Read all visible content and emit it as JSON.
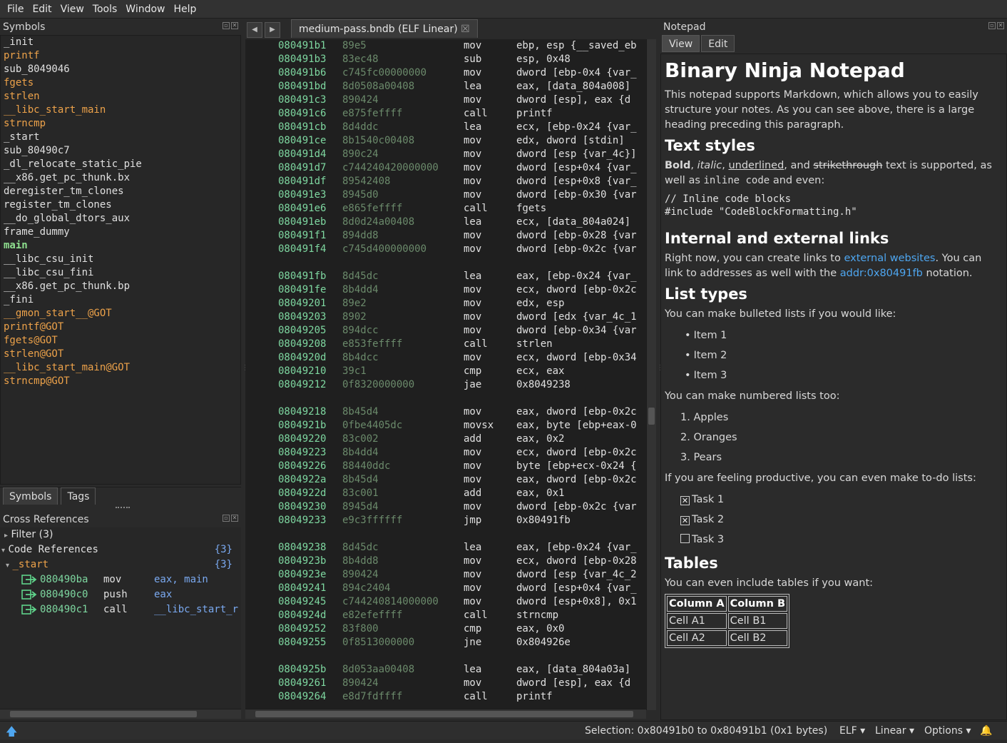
{
  "menu": [
    "File",
    "Edit",
    "View",
    "Tools",
    "Window",
    "Help"
  ],
  "symbols_pane": {
    "title": "Symbols",
    "items": [
      {
        "name": "_init",
        "color": "white"
      },
      {
        "name": "printf",
        "color": "orange"
      },
      {
        "name": "sub_8049046",
        "color": "white"
      },
      {
        "name": "fgets",
        "color": "orange"
      },
      {
        "name": "strlen",
        "color": "orange"
      },
      {
        "name": "__libc_start_main",
        "color": "orange"
      },
      {
        "name": "strncmp",
        "color": "orange"
      },
      {
        "name": "_start",
        "color": "white"
      },
      {
        "name": "sub_80490c7",
        "color": "white"
      },
      {
        "name": "_dl_relocate_static_pie",
        "color": "white"
      },
      {
        "name": "__x86.get_pc_thunk.bx",
        "color": "white"
      },
      {
        "name": "deregister_tm_clones",
        "color": "white"
      },
      {
        "name": "register_tm_clones",
        "color": "white"
      },
      {
        "name": "__do_global_dtors_aux",
        "color": "white"
      },
      {
        "name": "frame_dummy",
        "color": "white"
      },
      {
        "name": "main",
        "color": "green"
      },
      {
        "name": "__libc_csu_init",
        "color": "white"
      },
      {
        "name": "__libc_csu_fini",
        "color": "white"
      },
      {
        "name": "__x86.get_pc_thunk.bp",
        "color": "white"
      },
      {
        "name": "_fini",
        "color": "white"
      },
      {
        "name": "__gmon_start__@GOT",
        "color": "orange"
      },
      {
        "name": "printf@GOT",
        "color": "orange"
      },
      {
        "name": "fgets@GOT",
        "color": "orange"
      },
      {
        "name": "strlen@GOT",
        "color": "orange"
      },
      {
        "name": "__libc_start_main@GOT",
        "color": "orange"
      },
      {
        "name": "strncmp@GOT",
        "color": "orange"
      }
    ],
    "tabs": [
      "Symbols",
      "Tags"
    ]
  },
  "xref_pane": {
    "title": "Cross References",
    "filter": "Filter (3)",
    "code_refs": "Code References",
    "code_refs_count": "{3}",
    "group": "_start",
    "group_count": "{3}",
    "rows": [
      {
        "addr": "080490ba",
        "op": "mov",
        "args": "eax, main"
      },
      {
        "addr": "080490c0",
        "op": "push",
        "args": "eax"
      },
      {
        "addr": "080490c1",
        "op": "call",
        "args": "__libc_start_r"
      }
    ]
  },
  "editor": {
    "tab_label": "medium-pass.bndb (ELF Linear)",
    "lines": [
      {
        "a": "080491b1",
        "b": "89e5",
        "m": "mov",
        "o": "ebp, esp {__saved_eb"
      },
      {
        "a": "080491b3",
        "b": "83ec48",
        "m": "sub",
        "o": "esp, 0x48"
      },
      {
        "a": "080491b6",
        "b": "c745fc00000000",
        "m": "mov",
        "o": "dword [ebp-0x4 {var_"
      },
      {
        "a": "080491bd",
        "b": "8d0508a00408",
        "m": "lea",
        "o": "eax, [data_804a008]"
      },
      {
        "a": "080491c3",
        "b": "890424",
        "m": "mov",
        "o": "dword [esp], eax  {d"
      },
      {
        "a": "080491c6",
        "b": "e875feffff",
        "m": "call",
        "o": "printf"
      },
      {
        "a": "080491cb",
        "b": "8d4ddc",
        "m": "lea",
        "o": "ecx, [ebp-0x24 {var_"
      },
      {
        "a": "080491ce",
        "b": "8b1540c00408",
        "m": "mov",
        "o": "edx, dword [stdin]"
      },
      {
        "a": "080491d4",
        "b": "890c24",
        "m": "mov",
        "o": "dword [esp {var_4c}]"
      },
      {
        "a": "080491d7",
        "b": "c744240420000000",
        "m": "mov",
        "o": "dword [esp+0x4 {var_"
      },
      {
        "a": "080491df",
        "b": "89542408",
        "m": "mov",
        "o": "dword [esp+0x8 {var_"
      },
      {
        "a": "080491e3",
        "b": "8945d0",
        "m": "mov",
        "o": "dword [ebp-0x30 {var"
      },
      {
        "a": "080491e6",
        "b": "e865feffff",
        "m": "call",
        "o": "fgets"
      },
      {
        "a": "080491eb",
        "b": "8d0d24a00408",
        "m": "lea",
        "o": "ecx, [data_804a024]"
      },
      {
        "a": "080491f1",
        "b": "894dd8",
        "m": "mov",
        "o": "dword [ebp-0x28 {var"
      },
      {
        "a": "080491f4",
        "b": "c745d400000000",
        "m": "mov",
        "o": "dword [ebp-0x2c {var"
      },
      {
        "a": "",
        "b": "",
        "m": "",
        "o": ""
      },
      {
        "a": "080491fb",
        "b": "8d45dc",
        "m": "lea",
        "o": "eax, [ebp-0x24 {var_"
      },
      {
        "a": "080491fe",
        "b": "8b4dd4",
        "m": "mov",
        "o": "ecx, dword [ebp-0x2c"
      },
      {
        "a": "08049201",
        "b": "89e2",
        "m": "mov",
        "o": "edx, esp"
      },
      {
        "a": "08049203",
        "b": "8902",
        "m": "mov",
        "o": "dword [edx {var_4c_1"
      },
      {
        "a": "08049205",
        "b": "894dcc",
        "m": "mov",
        "o": "dword [ebp-0x34 {var"
      },
      {
        "a": "08049208",
        "b": "e853feffff",
        "m": "call",
        "o": "strlen"
      },
      {
        "a": "0804920d",
        "b": "8b4dcc",
        "m": "mov",
        "o": "ecx, dword [ebp-0x34"
      },
      {
        "a": "08049210",
        "b": "39c1",
        "m": "cmp",
        "o": "ecx, eax"
      },
      {
        "a": "08049212",
        "b": "0f8320000000",
        "m": "jae",
        "o": "0x8049238"
      },
      {
        "a": "",
        "b": "",
        "m": "",
        "o": ""
      },
      {
        "a": "08049218",
        "b": "8b45d4",
        "m": "mov",
        "o": "eax, dword [ebp-0x2c"
      },
      {
        "a": "0804921b",
        "b": "0fbe4405dc",
        "m": "movsx",
        "o": "eax, byte [ebp+eax-0"
      },
      {
        "a": "08049220",
        "b": "83c002",
        "m": "add",
        "o": "eax, 0x2"
      },
      {
        "a": "08049223",
        "b": "8b4dd4",
        "m": "mov",
        "o": "ecx, dword [ebp-0x2c"
      },
      {
        "a": "08049226",
        "b": "88440ddc",
        "m": "mov",
        "o": "byte [ebp+ecx-0x24 {"
      },
      {
        "a": "0804922a",
        "b": "8b45d4",
        "m": "mov",
        "o": "eax, dword [ebp-0x2c"
      },
      {
        "a": "0804922d",
        "b": "83c001",
        "m": "add",
        "o": "eax, 0x1"
      },
      {
        "a": "08049230",
        "b": "8945d4",
        "m": "mov",
        "o": "dword [ebp-0x2c {var"
      },
      {
        "a": "08049233",
        "b": "e9c3ffffff",
        "m": "jmp",
        "o": "0x80491fb"
      },
      {
        "a": "",
        "b": "",
        "m": "",
        "o": ""
      },
      {
        "a": "08049238",
        "b": "8d45dc",
        "m": "lea",
        "o": "eax, [ebp-0x24 {var_"
      },
      {
        "a": "0804923b",
        "b": "8b4dd8",
        "m": "mov",
        "o": "ecx, dword [ebp-0x28"
      },
      {
        "a": "0804923e",
        "b": "890424",
        "m": "mov",
        "o": "dword [esp {var_4c_2"
      },
      {
        "a": "08049241",
        "b": "894c2404",
        "m": "mov",
        "o": "dword [esp+0x4 {var_"
      },
      {
        "a": "08049245",
        "b": "c744240814000000",
        "m": "mov",
        "o": "dword [esp+0x8], 0x1"
      },
      {
        "a": "0804924d",
        "b": "e82efeffff",
        "m": "call",
        "o": "strncmp"
      },
      {
        "a": "08049252",
        "b": "83f800",
        "m": "cmp",
        "o": "eax, 0x0"
      },
      {
        "a": "08049255",
        "b": "0f8513000000",
        "m": "jne",
        "o": "0x804926e"
      },
      {
        "a": "",
        "b": "",
        "m": "",
        "o": ""
      },
      {
        "a": "0804925b",
        "b": "8d053aa00408",
        "m": "lea",
        "o": "eax, [data_804a03a]"
      },
      {
        "a": "08049261",
        "b": "890424",
        "m": "mov",
        "o": "dword [esp], eax  {d"
      },
      {
        "a": "08049264",
        "b": "e8d7fdffff",
        "m": "call",
        "o": "printf"
      }
    ]
  },
  "notepad": {
    "title": "Notepad",
    "tabs": [
      "View",
      "Edit"
    ],
    "h1": "Binary Ninja Notepad",
    "intro": "This notepad supports Markdown, which allows you to easily structure your notes. As you can see above, there is a large heading preceding this paragraph.",
    "h_styles": "Text styles",
    "styles_bold": "Bold",
    "styles_italic": "italic",
    "styles_underlined": "underlined",
    "styles_and": ", and ",
    "styles_strike": "strikethrough",
    "styles_tail": " text is supported, as well as ",
    "styles_inline": "inline code",
    "styles_end": " and even:",
    "code_line1": "// Inline code blocks",
    "code_line2": "#include \"CodeBlockFormatting.h\"",
    "h_links": "Internal and external links",
    "links_p1": "Right now, you can create links to ",
    "links_ext": "external websites",
    "links_p2": ". You can link to addresses as well with the ",
    "links_addr": "addr:0x80491fb",
    "links_p3": " notation.",
    "h_lists": "List types",
    "bullets_intro": "You can make bulleted lists if you would like:",
    "bullets": [
      "Item 1",
      "Item 2",
      "Item 3"
    ],
    "numbered_intro": "You can make numbered lists too:",
    "numbered": [
      "1. Apples",
      "2. Oranges",
      "3. Pears"
    ],
    "todo_intro": "If you are feeling productive, you can even make to-do lists:",
    "todos": [
      {
        "label": "Task 1",
        "checked": true
      },
      {
        "label": "Task 2",
        "checked": true
      },
      {
        "label": "Task 3",
        "checked": false
      }
    ],
    "h_tables": "Tables",
    "tables_intro": "You can even include tables if you want:",
    "table_headers": [
      "Column A",
      "Column B"
    ],
    "table_rows": [
      [
        "Cell A1",
        "Cell B1"
      ],
      [
        "Cell A2",
        "Cell B2"
      ]
    ]
  },
  "status": {
    "selection": "Selection: 0x80491b0 to 0x80491b1 (0x1 bytes)",
    "elf": "ELF ▾",
    "linear": "Linear ▾",
    "options": "Options ▾"
  }
}
